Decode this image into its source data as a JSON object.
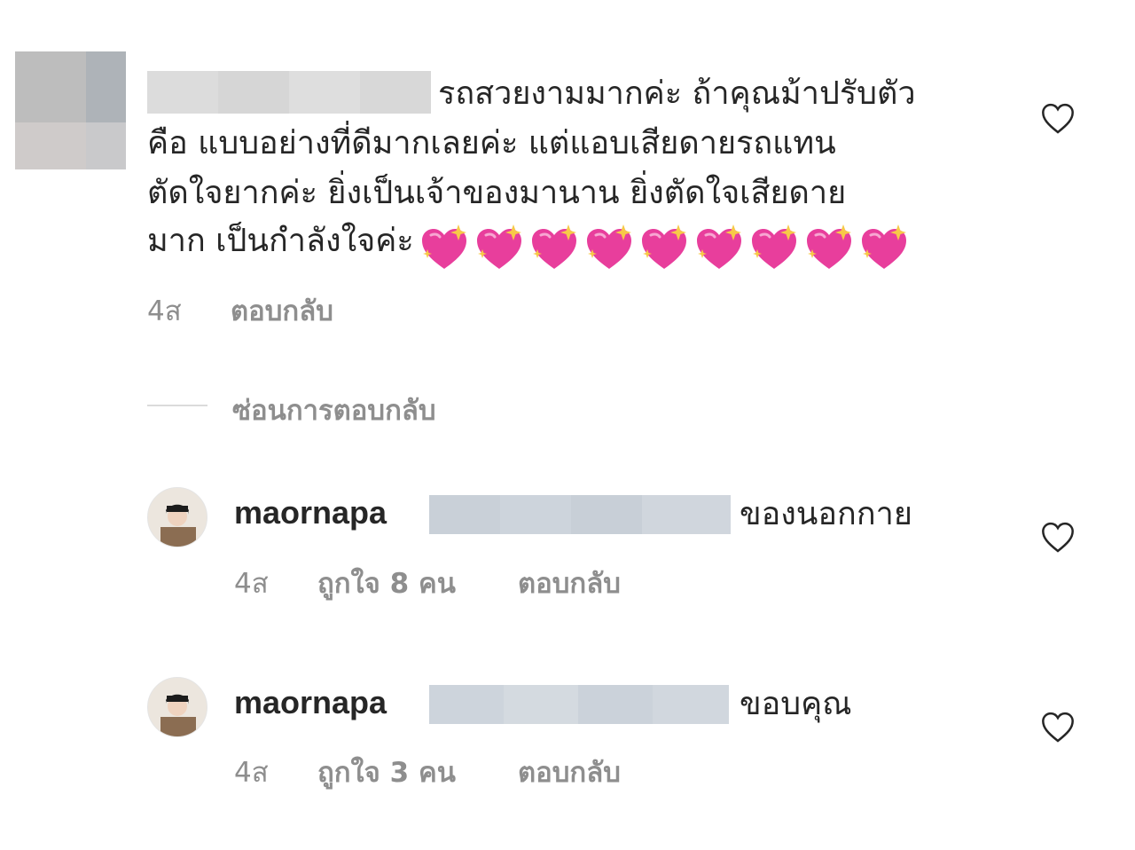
{
  "comment": {
    "text_line1": "รถสวยงามมากค่ะ ถ้าคุณม้าปรับตัว",
    "text_line2": "คือ แบบอย่างที่ดีมากเลยค่ะ แต่แอบเสียดายรถแทน",
    "text_line3": "ตัดใจยากค่ะ ยิ่งเป็นเจ้าของมานาน ยิ่งตัดใจเสียดาย",
    "text_line4": "มาก เป็นกำลังใจค่ะ",
    "emoji": "sparkling-heart",
    "emoji_count": 9,
    "time": "4ส",
    "reply_label": "ตอบกลับ"
  },
  "hide_replies_label": "ซ่อนการตอบกลับ",
  "replies": [
    {
      "username": "maornapa",
      "text": "ของนอกกาย",
      "time": "4ส",
      "likes_label": "ถูกใจ 8 คน",
      "reply_label": "ตอบกลับ"
    },
    {
      "username": "maornapa",
      "text": "ขอบคุณ",
      "time": "4ส",
      "likes_label": "ถูกใจ 3 คน",
      "reply_label": "ตอบกลับ"
    }
  ],
  "icons": {
    "like": "heart-outline-icon"
  },
  "colors": {
    "text": "#262626",
    "secondary": "#8e8e8e",
    "heart_emoji": "#e83e9c"
  }
}
